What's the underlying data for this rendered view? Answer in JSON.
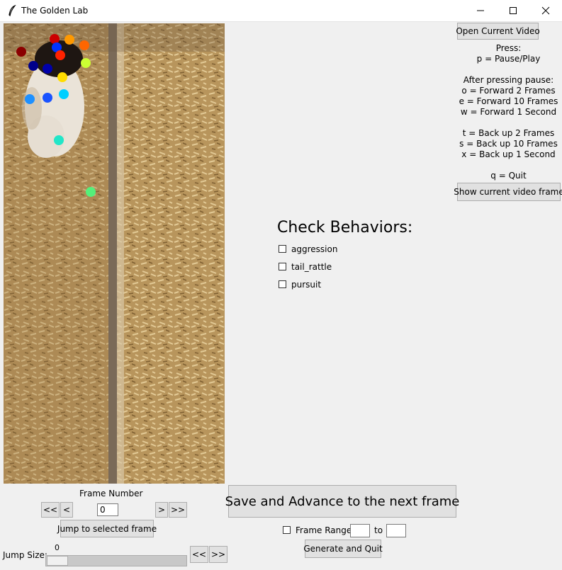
{
  "window": {
    "title": "The Golden Lab"
  },
  "sidebar": {
    "open_video_label": "Open Current Video",
    "help_lines": [
      "Press:",
      "p = Pause/Play",
      "",
      "After pressing pause:",
      "o = Forward 2 Frames",
      "e = Forward 10 Frames",
      "w = Forward 1 Second",
      "",
      "t = Back up 2 Frames",
      "s = Back up 10 Frames",
      "x = Back up 1 Second",
      "",
      "q = Quit"
    ],
    "show_frame_label": "Show current video frame"
  },
  "behaviors": {
    "heading": "Check Behaviors:",
    "items": [
      {
        "label": "aggression",
        "checked": false
      },
      {
        "label": "tail_rattle",
        "checked": false
      },
      {
        "label": "pursuit",
        "checked": false
      }
    ]
  },
  "video": {
    "keypoints": [
      {
        "name": "kp-1",
        "color": "#8b0000"
      },
      {
        "name": "kp-2",
        "color": "#cc0000"
      },
      {
        "name": "kp-3",
        "color": "#ff9900"
      },
      {
        "name": "kp-4",
        "color": "#ff6600"
      },
      {
        "name": "kp-5",
        "color": "#0033ff"
      },
      {
        "name": "kp-6",
        "color": "#ff2200"
      },
      {
        "name": "kp-7",
        "color": "#00008b"
      },
      {
        "name": "kp-8",
        "color": "#0000aa"
      },
      {
        "name": "kp-9",
        "color": "#ccff33"
      },
      {
        "name": "kp-10",
        "color": "#ffdd00"
      },
      {
        "name": "kp-11",
        "color": "#1e90ff"
      },
      {
        "name": "kp-12",
        "color": "#1a53ff"
      },
      {
        "name": "kp-13",
        "color": "#00cfff"
      },
      {
        "name": "kp-14",
        "color": "#22e6c8"
      },
      {
        "name": "kp-15",
        "color": "#55f07a"
      }
    ]
  },
  "frame_nav": {
    "label": "Frame Number",
    "value": "0",
    "back_fast": "<<",
    "back": "<",
    "forward": ">",
    "forward_fast": ">>",
    "jump_label": "Jump to selected frame",
    "jump_size_label": "Jump Size:",
    "jump_size_value": "0",
    "jump_back": "<<",
    "jump_forward": ">>"
  },
  "actions": {
    "save_label": "Save and Advance to the next frame",
    "range_label": "Frame Range",
    "range_to": "to",
    "range_from_value": "",
    "range_to_value": "",
    "generate_label": "Generate and Quit"
  }
}
